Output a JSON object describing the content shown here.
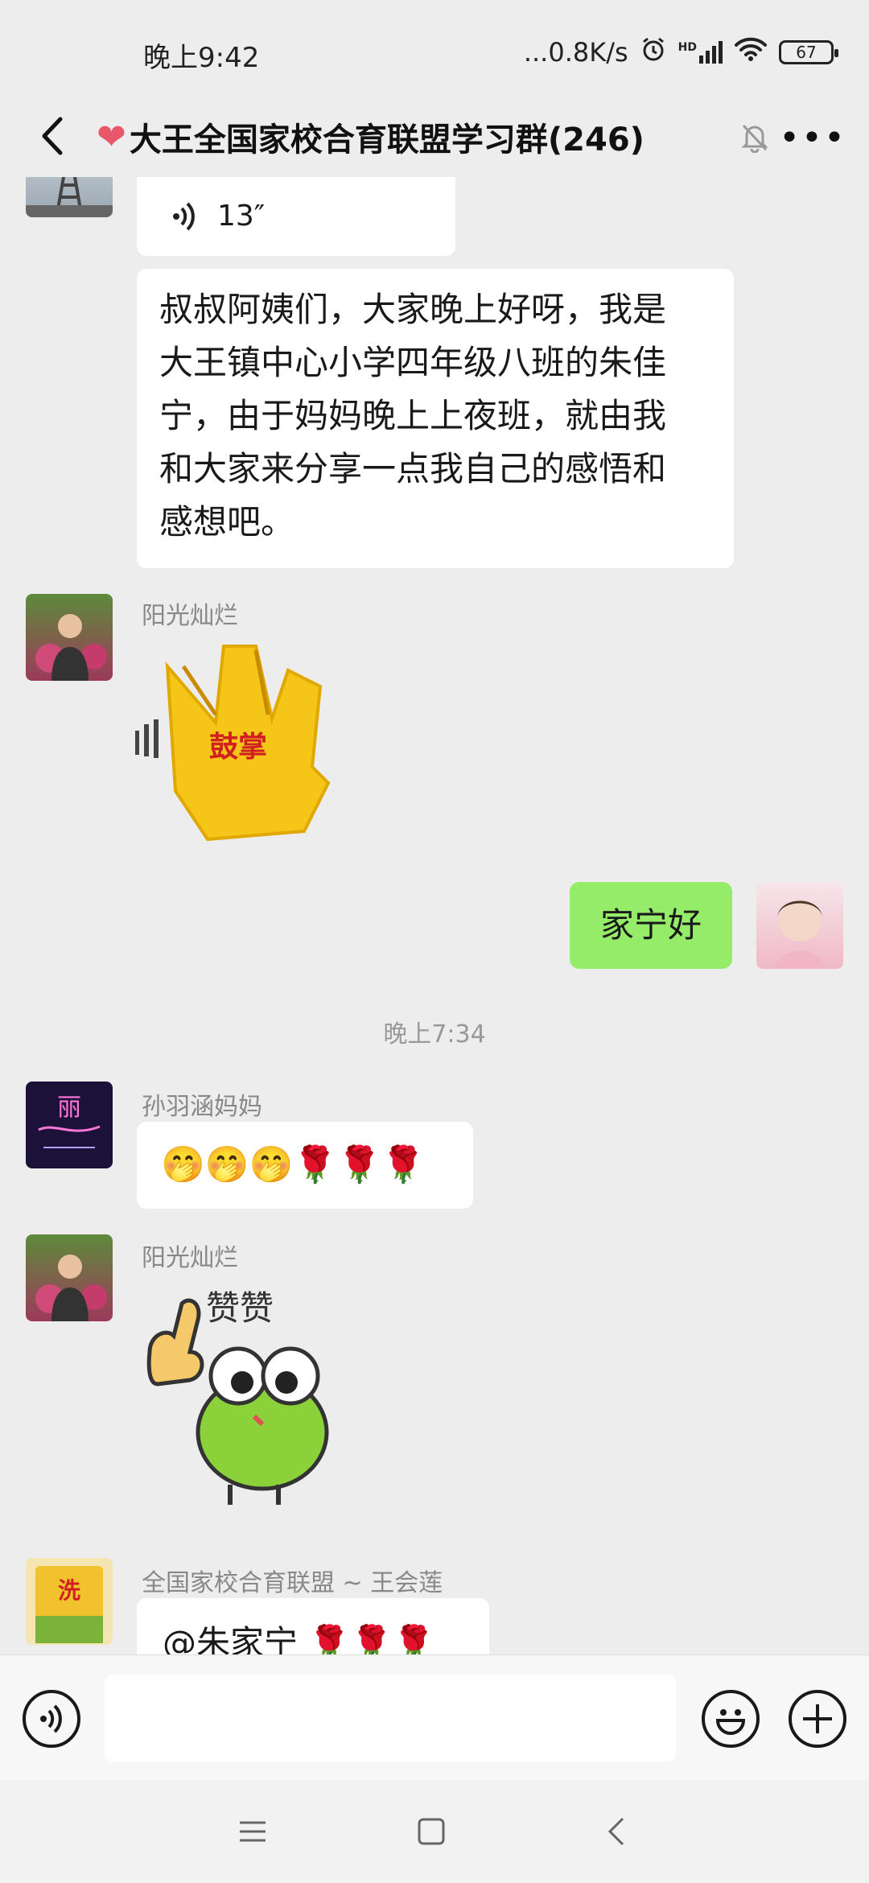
{
  "status_bar": {
    "time": "晚上9:42",
    "network_speed": "...0.8K/s",
    "alarm_icon": "alarm-icon",
    "signal_label": "HD",
    "battery": "67"
  },
  "header": {
    "title": "大王全国家校合育联盟学习群(246)",
    "heart": "❤",
    "more": "•••"
  },
  "messages": {
    "voice": {
      "duration": "13″"
    },
    "text1": {
      "line1": "叔叔阿姨们，大家晚上好呀，我是",
      "line2": "大王镇中心小学四年级八班的朱佳",
      "line3": "宁，由于妈妈晚上上夜班，就由我",
      "line4": "和大家来分享一点我自己的感悟和",
      "line5": "感想吧。"
    },
    "sticker_clap": {
      "sender": "阳光灿烂",
      "text": "鼓掌"
    },
    "mine": {
      "text": "家宁好"
    },
    "divider_time": "晚上7:34",
    "emoji_msg": {
      "sender": "孙羽涵妈妈",
      "text": "🤭🤭🤭🌹🌹🌹",
      "avatar_text": "丽"
    },
    "sticker_zan": {
      "sender": "阳光灿烂",
      "text": "赞赞"
    },
    "last": {
      "sender": "全国家校合育联盟 ~ 王会莲",
      "text": "@朱家宁 🌹🌹🌹",
      "avatar_text": "洗"
    }
  },
  "input": {
    "placeholder": ""
  },
  "colors": {
    "background": "#ededed",
    "my_bubble": "#95ec69",
    "other_bubble": "#ffffff"
  }
}
